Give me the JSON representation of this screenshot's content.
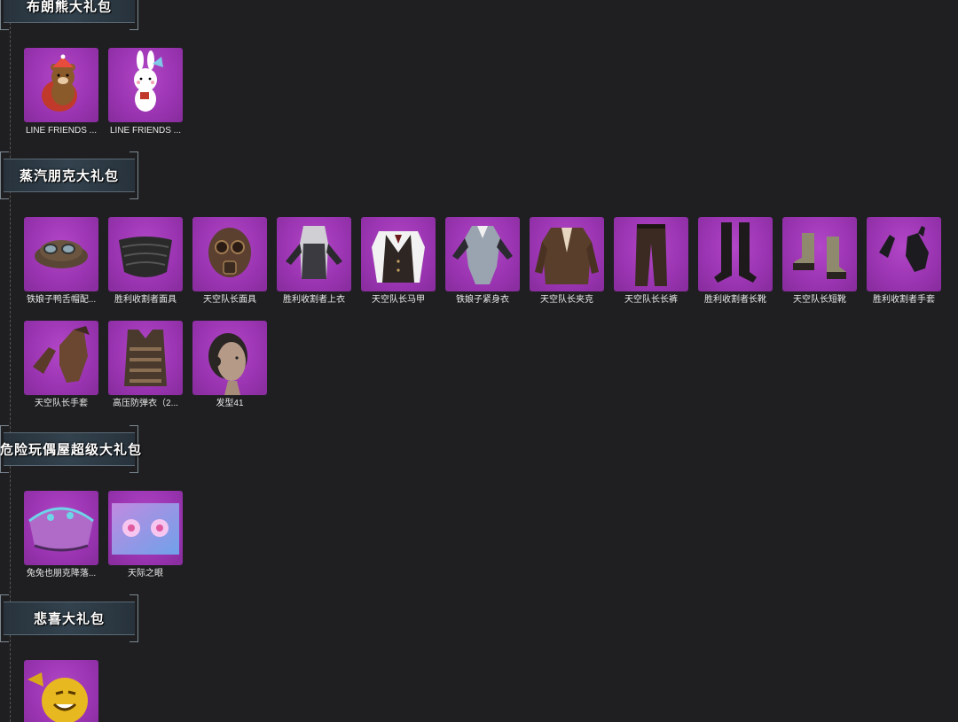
{
  "sections": [
    {
      "title": "布朗熊大礼包",
      "items": [
        {
          "label": "LINE FRIENDS ...",
          "icon": "brown-bear-icon"
        },
        {
          "label": "LINE FRIENDS ...",
          "icon": "cony-bunny-icon"
        }
      ]
    },
    {
      "title": "蒸汽朋克大礼包",
      "items": [
        {
          "label": "铁娘子鸭舌帽配...",
          "icon": "cap-icon"
        },
        {
          "label": "胜利收割者面具",
          "icon": "mask-icon"
        },
        {
          "label": "天空队长面具",
          "icon": "gas-mask-icon"
        },
        {
          "label": "胜利收割者上衣",
          "icon": "top-icon"
        },
        {
          "label": "天空队长马甲",
          "icon": "vest-icon"
        },
        {
          "label": "铁娘子紧身衣",
          "icon": "bodysuit-icon"
        },
        {
          "label": "天空队长夹克",
          "icon": "jacket-icon"
        },
        {
          "label": "天空队长长裤",
          "icon": "pants-icon"
        },
        {
          "label": "胜利收割者长靴",
          "icon": "long-boots-icon"
        },
        {
          "label": "天空队长短靴",
          "icon": "short-boots-icon"
        },
        {
          "label": "胜利收割者手套",
          "icon": "gloves-icon"
        },
        {
          "label": "天空队长手套",
          "icon": "brown-gloves-icon"
        },
        {
          "label": "高压防弹衣（2...",
          "icon": "armor-vest-icon"
        },
        {
          "label": "发型41",
          "icon": "hairstyle-icon"
        }
      ]
    },
    {
      "title": "危险玩偶屋超级大礼包",
      "items": [
        {
          "label": "兔兔也朋克降落...",
          "icon": "parachute-icon"
        },
        {
          "label": "天际之眼",
          "icon": "sky-eye-icon"
        }
      ]
    },
    {
      "title": "悲喜大礼包",
      "items": [
        {
          "label": "",
          "icon": "golden-mask-icon"
        }
      ]
    }
  ]
}
